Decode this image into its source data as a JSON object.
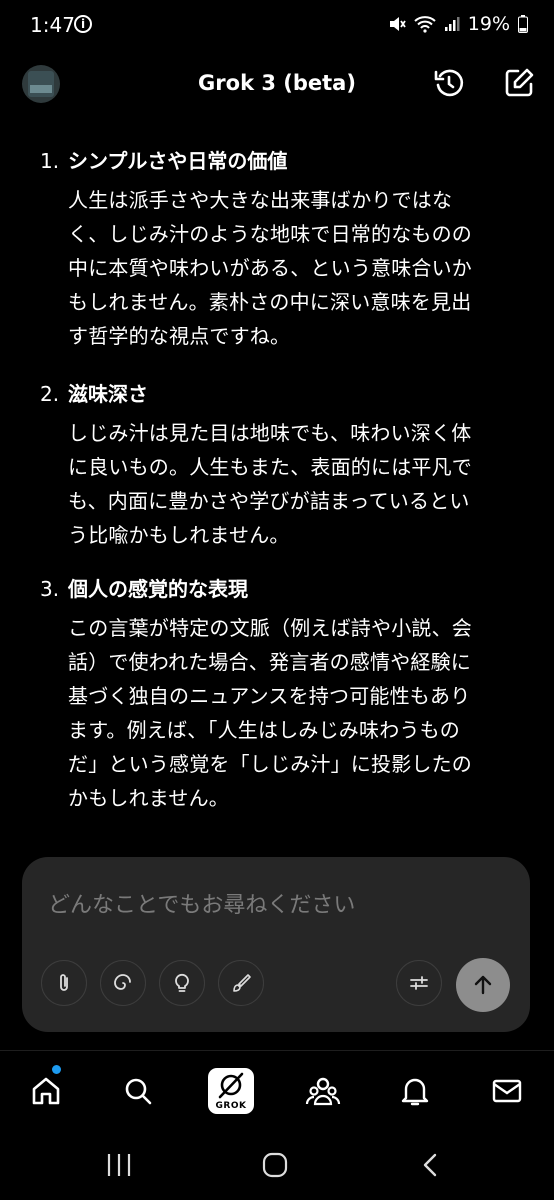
{
  "status_bar": {
    "time": "1:47",
    "battery": "19%"
  },
  "header": {
    "title": "Grok 3 (beta)"
  },
  "items": [
    {
      "number": "1.",
      "heading": "シンプルさや日常の価値",
      "lines": [
        "人生は派手さや大きな出来事ばかりではな",
        "く、しじみ汁のような地味で日常的なものの",
        "中に本質や味わいがある、という意味合いか",
        "もしれません。素朴さの中に深い意味を見出",
        "す哲学的な視点ですね。"
      ]
    },
    {
      "number": "2.",
      "heading": "滋味深さ",
      "lines": [
        "しじみ汁は見た目は地味でも、味わい深く体",
        "に良いもの。人生もまた、表面的には平凡で",
        "も、内面に豊かさや学びが詰まっているとい",
        "う比喩かもしれません。"
      ]
    },
    {
      "number": "3.",
      "heading": "個人の感覚的な表現",
      "lines": [
        "この言葉が特定の文脈（例えば詩や小説、会",
        "話）で使われた場合、発言者の感情や経験に",
        "基づく独自のニュアンスを持つ可能性もあり",
        "ます。例えば、「人生はしみじみ味わうもの",
        "だ」という感覚を「しじみ汁」に投影したの",
        "かもしれません。"
      ]
    }
  ],
  "composer": {
    "placeholder": "どんなことでもお尋ねください"
  },
  "nav": {
    "grok_label": "GROK"
  }
}
